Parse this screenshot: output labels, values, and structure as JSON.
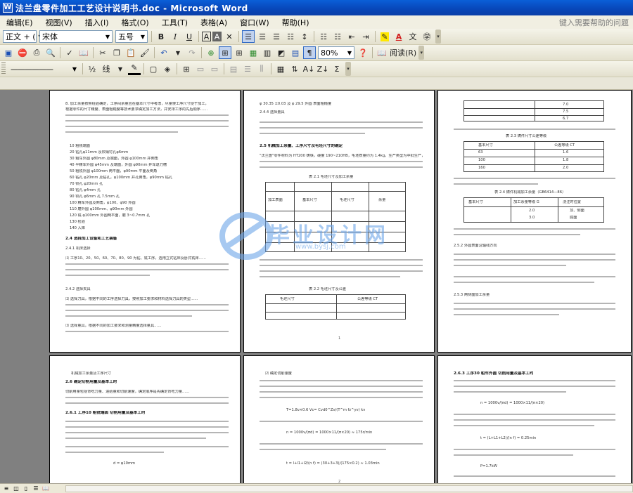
{
  "window": {
    "title": "法兰盘零件加工工艺设计说明书.doc - Microsoft Word"
  },
  "menubar": {
    "items": [
      "编辑(E)",
      "视图(V)",
      "插入(I)",
      "格式(O)",
      "工具(T)",
      "表格(A)",
      "窗口(W)",
      "帮助(H)"
    ],
    "help_placeholder": "键入需要帮助的问题"
  },
  "format_toolbar": {
    "style_value": "正文 + (",
    "font_value": "宋体",
    "size_value": "五号",
    "bold": "B",
    "italic": "I",
    "underline": "U",
    "char_border": "A",
    "char_shading": "A",
    "phonetic": "文"
  },
  "standard_toolbar": {
    "zoom_value": "80%",
    "reading_label": "阅读(R)"
  },
  "drawing_toolbar": {
    "line_style": "——————",
    "wrap_label": "线",
    "sigma": "Σ"
  },
  "pages": [
    {
      "lines": [
        "8. 加工余量按照经验确定，工序间余量应在基本尺寸中考虑，尽量使工序尺寸便于加工，",
        "根据零件的尺寸精度、表面粗糙度等技术要求确定加工方法，并安排工序的先后顺序……",
        "10 粗铣端面",
        "20 钻孔φ11mm 及铰销钉孔φ6mm",
        "30 粗车外圆 φ80mm 及端面，外圆 φ100mm 并倒角",
        "40 半精车外圆 φ45mm 及端面，外圆 φ90mm 并车退刀槽",
        "50 粗铣外圆 φ100mm 两平面，φ90mm 平面及倒角",
        "60 钻孔 φ20mm 及钻孔，φ100mm 并孔倒角，φ90mm 钻孔",
        "70 铰孔 φ20mm 孔",
        "80 钻孔 φ4mm 孔",
        "90 铰孔 φ6mm 孔 7.5mm 孔",
        "100 精车外圆及倒角，φ100、φ90 外圆",
        "110 磨外圆 φ100mm、φ90mm 外圆",
        "120 铣 φ100mm 外圆两平面，磨 3~0.7mm 孔",
        "130 检验",
        "140 入库"
      ],
      "heading": "2.4 选择加工设备和工艺装备",
      "sub_heading_1": "2.4.1 机床选择",
      "para_1": "⑴ 工序10、20、50、60、70、80、90 为钻、铣工序，选用立式钻床及卧式铣床……",
      "sub_heading_2": "2.4.2 选择夹具",
      "para_2": "⑵ 选择刀具，根据不同的工序选择刀具，按照加工要求和材料选择刀具的类型……",
      "para_3": "⑶ 选择量具，根据不同的加工要求和测量精度选择量具……"
    },
    {
      "top_line": "φ 30.35 ±0.03 及 φ 29.5 外圆 表面粗糙度",
      "sub_heading": "2.4.4 选择量具",
      "heading": "2.5 机械加工余量、工序尺寸及毛坯尺寸的确定",
      "para": "\"法兰盘\"零件材料为 HT200 铸铁，硬度 190~210HB，毛坯质量约为 1.4kg，生产类型为中批生产，采用铸造毛坯……",
      "table_caption": "表 2.1 毛坯尺寸及加工余量",
      "table_headers": [
        "加工表面",
        "基本尺寸",
        "毛坯尺寸",
        "余量"
      ],
      "table_caption_2": "表 2.2 毛坯尺寸及公差",
      "table_2_headers": [
        "毛坯尺寸",
        "公差等级 CT"
      ],
      "footer": "1"
    },
    {
      "table_values": [
        "7.0",
        "7.5",
        "6.7"
      ],
      "caption_1": "表 2.3 铸件尺寸公差等级",
      "table_headers": [
        "基本尺寸",
        "公差等级 CT"
      ],
      "rows": [
        [
          "63",
          "1.6"
        ],
        [
          "100",
          "1.8"
        ],
        [
          "160",
          "2.0"
        ]
      ],
      "caption_2": "表 2.4 铸件机械加工余量（GB6414—86）",
      "table_headers_2": [
        "基本尺寸",
        "加工余量等级 G",
        "浇注时位置"
      ],
      "cells_2": [
        "2.0",
        "3.0",
        "顶、侧面",
        "底面"
      ],
      "sub_heading": "2.5.2 外圆表面沿轴线方向",
      "sub_heading_2": "2.5.3 两侧面加工余量"
    },
    {
      "top_line": "机械加工余量及工序尺寸",
      "heading": "2.6 确定切削用量及基本工时",
      "para": "切削用量包括背吃刀量、进给量和切削速度，确定顺序是先确定背吃刀量……",
      "sub_heading": "2.6.1 工序10 粗铣端面 切削用量及基本工时",
      "formula": "d = φ10mm"
    },
    {
      "top_line": "⑵ 确定切削速度",
      "formula_1": "T=1.8ν×0.6 Vc= Cvd0^Zv/(T^m fz^yv) kv",
      "formula_2": "n = 1000v/(πd) = 1000×11/(π×20) ≈ 175r/min",
      "formula_3": "t = l+l1+l2/(n f) = (30+3+3)/(175×0.2) ≈ 1.03min",
      "footer": "2"
    },
    {
      "heading": "2.6.3 工序30 粗车外圆 切削用量及基本工时",
      "formula_1": "n = 1000v/(πd) = 1000×11/(π×20)",
      "formula_2": "t = (L+L1+L2)/(n f) = 0.25min",
      "formula_3": "P=1.7kW"
    }
  ],
  "watermark": {
    "text": "毕业设计网",
    "sub": "www.bysj.com"
  },
  "colors": {
    "title_bar": "#0846b8",
    "document_background": "#808080",
    "chrome": "#ece9d8"
  }
}
